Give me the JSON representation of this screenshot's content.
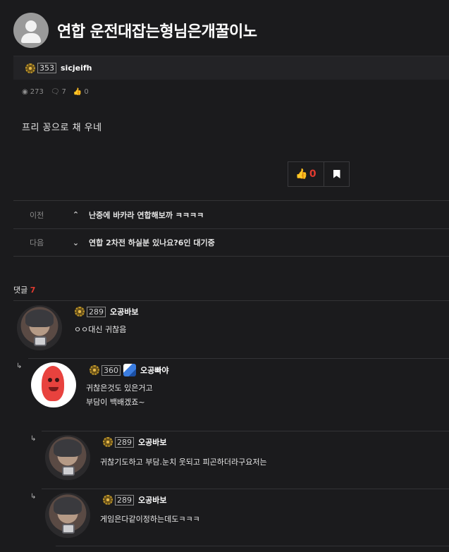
{
  "post": {
    "title": "연합 운전대잡는형님은개꿀이노",
    "author": {
      "level": "353",
      "name": "sicjeifh"
    },
    "stats": {
      "views": "273",
      "comments": "7",
      "likes": "0"
    },
    "content": "프리 꽁으로 채 우네",
    "vote": {
      "like_count": "0"
    }
  },
  "nav": {
    "prev": {
      "label": "이전",
      "title": "난중에 바카라 연합해보까 ㅋㅋㅋㅋ"
    },
    "next": {
      "label": "다음",
      "title": "연합 2차전 하실분 있나요?6인 대기중"
    }
  },
  "comments_header": {
    "label": "댓글",
    "count": "7"
  },
  "comments": [
    {
      "level": "289",
      "name": "오공바보",
      "lines": [
        "ㅇㅇ대신 귀찮음"
      ]
    },
    {
      "level": "360",
      "name": "오공빠야",
      "lines": [
        "귀찮은것도 있은거고",
        "부담이 백배겠죠~"
      ]
    },
    {
      "level": "289",
      "name": "오공바보",
      "lines": [
        "귀찮기도하고 부담.눈치 웃되고 피곤하더라구요저는"
      ]
    },
    {
      "level": "289",
      "name": "오공바보",
      "lines": [
        "게임은다같이정하는데도ㅋㅋㅋ"
      ]
    }
  ],
  "icons": {
    "reply": "reply-arrow-icon",
    "views": "eye-icon",
    "comments": "speech-bubble-icon",
    "likes": "thumbs-up-icon",
    "bookmark": "bookmark-icon"
  },
  "colors": {
    "background": "#1b1b1d",
    "accent": "#e13a2f"
  }
}
